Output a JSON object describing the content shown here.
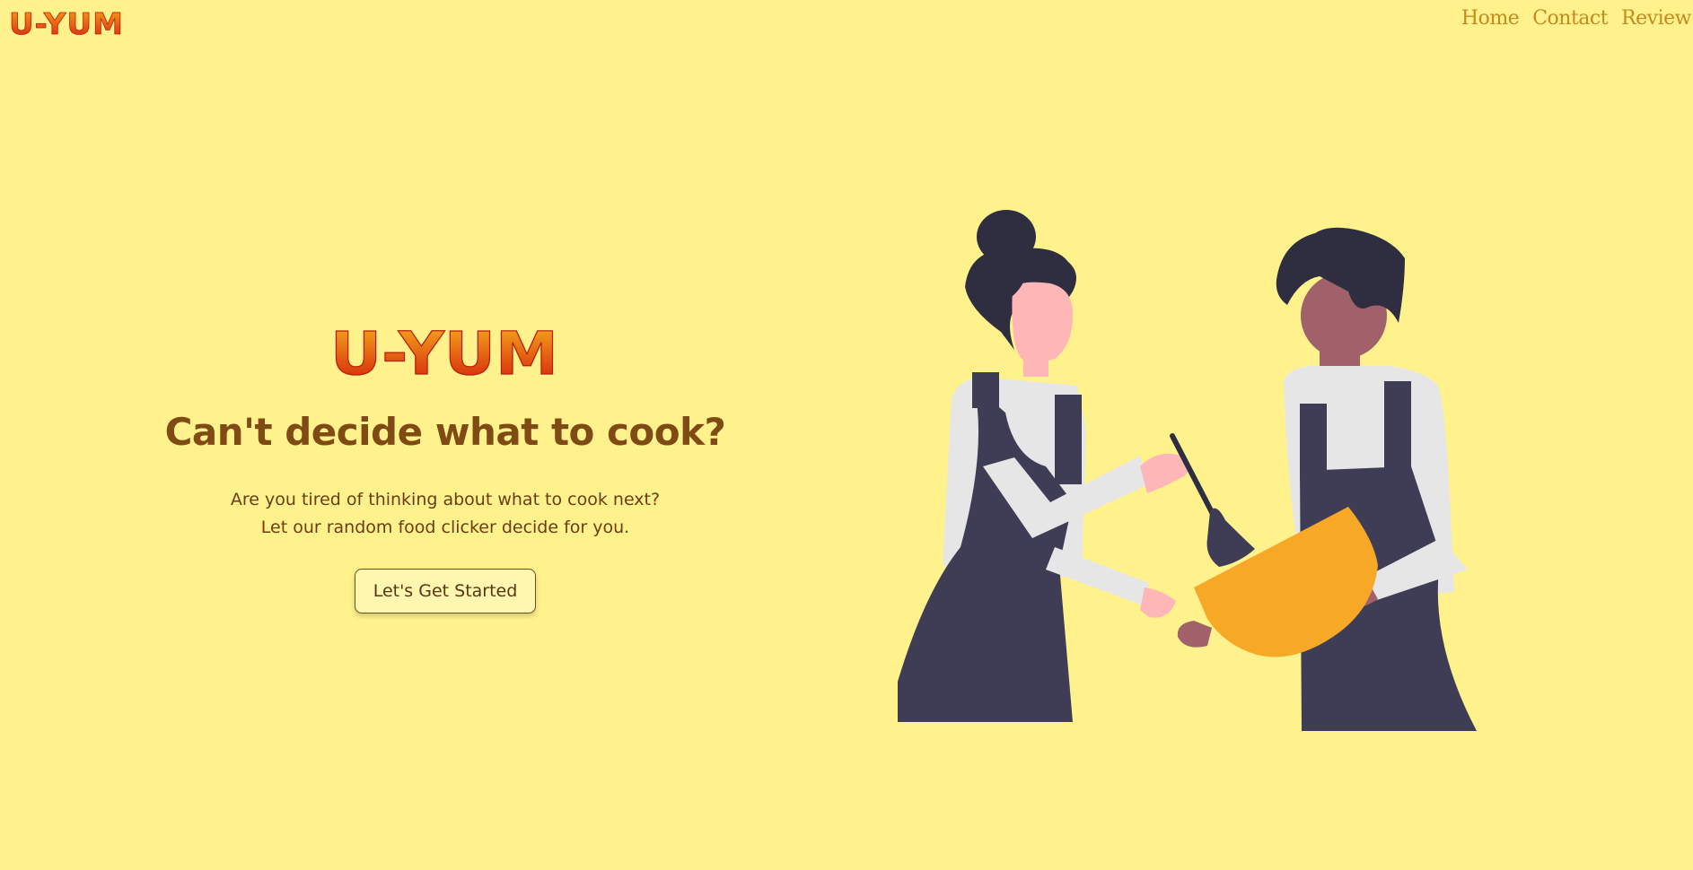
{
  "header": {
    "logo_text": "U-YUM",
    "nav": [
      {
        "label": "Home"
      },
      {
        "label": "Contact"
      },
      {
        "label": "Review"
      }
    ]
  },
  "hero": {
    "logo_text": "U-YUM",
    "headline": "Can't decide what to cook?",
    "subtext_line1": "Are you tired of thinking about what to cook next?",
    "subtext_line2": "Let our random food clicker decide for you.",
    "cta_label": "Let's Get Started"
  },
  "colors": {
    "background": "#fff28c",
    "logo_gradient_top": "#f6a91a",
    "logo_gradient_bottom": "#d7200c",
    "headline": "#7f4a14",
    "nav_link": "#c58a1f"
  },
  "illustration": {
    "description_icon": "two-chefs-cooking-illustration"
  }
}
